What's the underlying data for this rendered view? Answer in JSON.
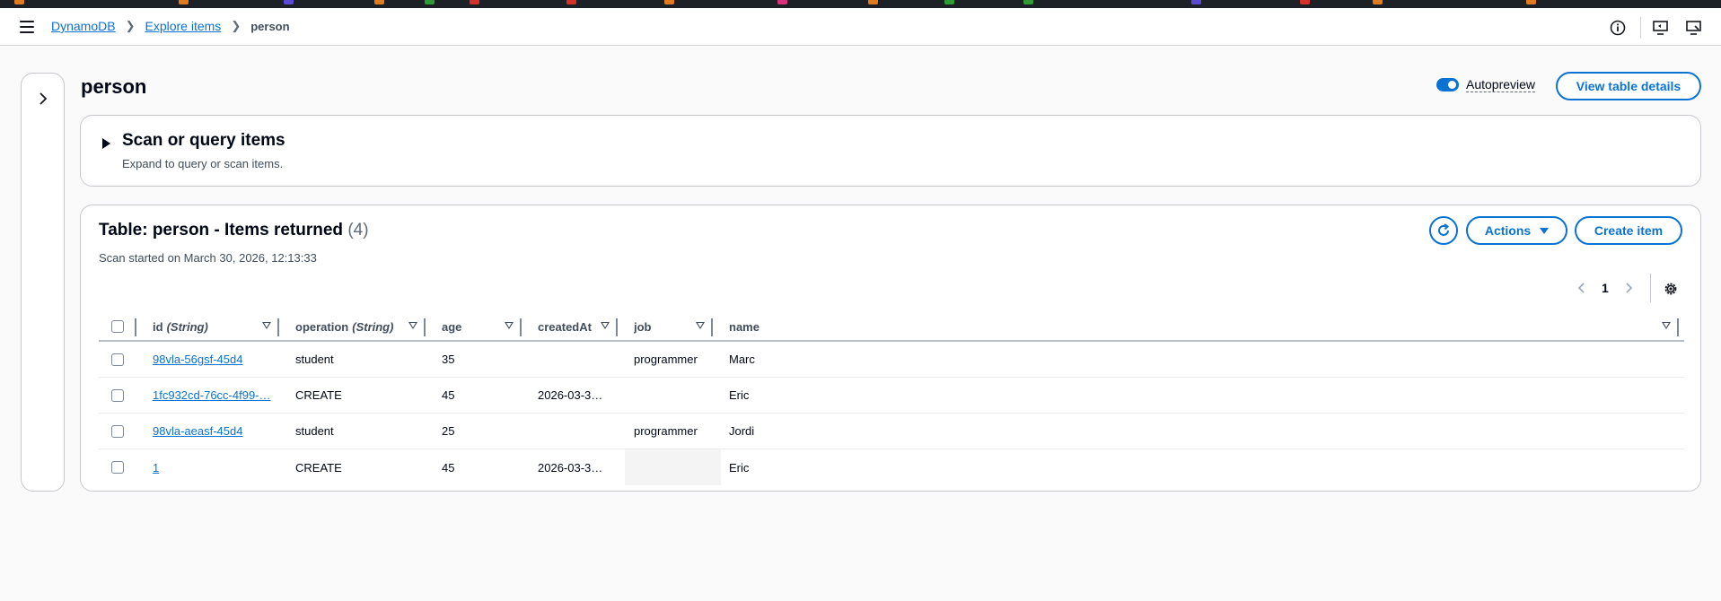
{
  "header": {
    "breadcrumbs": [
      {
        "label": "DynamoDB"
      },
      {
        "label": "Explore items"
      },
      {
        "label": "person"
      }
    ],
    "icons": [
      "menu-icon",
      "info-icon",
      "screen-share-icon",
      "monitor-icon"
    ]
  },
  "page": {
    "title": "person",
    "autopreview_label": "Autopreview",
    "autopreview_on": true,
    "view_details_label": "View table details"
  },
  "scan": {
    "title": "Scan or query items",
    "subtitle": "Expand to query or scan items."
  },
  "items": {
    "title": "Table: person - Items returned",
    "count": "(4)",
    "scan_started": "Scan started on March 30, 2026, 12:13:33",
    "actions_label": "Actions",
    "create_label": "Create item",
    "page_number": "1",
    "columns": [
      {
        "name": "id",
        "type": "(String)"
      },
      {
        "name": "operation",
        "type": "(String)"
      },
      {
        "name": "age",
        "type": ""
      },
      {
        "name": "createdAt",
        "type": ""
      },
      {
        "name": "job",
        "type": ""
      },
      {
        "name": "name",
        "type": ""
      }
    ],
    "rows": [
      {
        "id": "98vla-56gsf-45d4",
        "operation": "student",
        "age": "35",
        "createdAt": "",
        "job": "programmer",
        "name": "Marc"
      },
      {
        "id": "1fc932cd-76cc-4f99-…",
        "operation": "CREATE",
        "age": "45",
        "createdAt": "2026-03-3…",
        "job": "",
        "name": "Eric"
      },
      {
        "id": "98vla-aeasf-45d4",
        "operation": "student",
        "age": "25",
        "createdAt": "",
        "job": "programmer",
        "name": "Jordi"
      },
      {
        "id": "1",
        "operation": "CREATE",
        "age": "45",
        "createdAt": "2026-03-3…",
        "job": "",
        "name": "Eric"
      }
    ]
  },
  "colors": {
    "accent": "#0972d3",
    "text": "#000716",
    "border": "#c6c6cd"
  }
}
